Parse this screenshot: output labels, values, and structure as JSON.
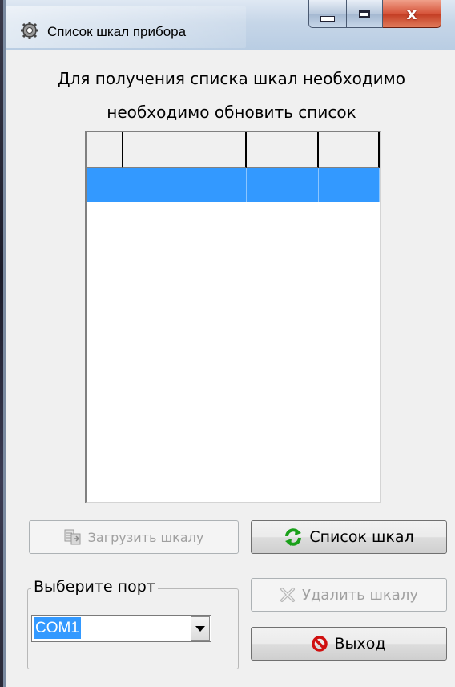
{
  "window": {
    "title": "Список шкал прибора",
    "close_glyph": "x"
  },
  "message": {
    "line1": "Для получения списка шкал необходимо",
    "line2": "необходимо обновить список"
  },
  "grid": {
    "columns": [
      "",
      "",
      "",
      ""
    ],
    "rows": [
      [
        "",
        "",
        "",
        ""
      ]
    ]
  },
  "buttons": {
    "load_label": "Загрузить шкалу",
    "list_label": "Список шкал",
    "delete_label": "Удалить шкалу",
    "exit_label": "Выход"
  },
  "port": {
    "legend": "Выберите порт",
    "selected": "COM1"
  },
  "colors": {
    "selection": "#3399ff",
    "refresh_green": "#1aa01a",
    "exit_red": "#d01010"
  }
}
